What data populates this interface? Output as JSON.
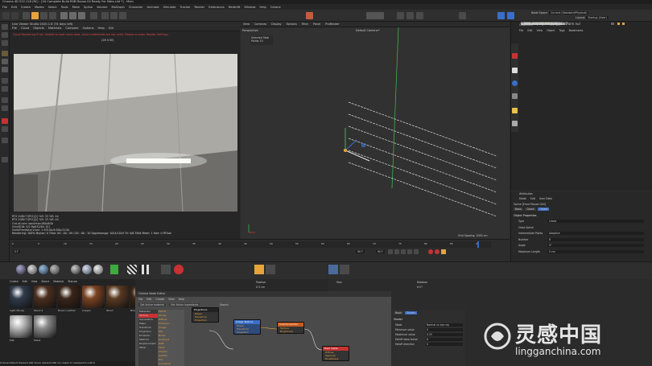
{
  "title": "Cinema 4D S22.118 (RC) - [04 Complete Build RSB Mouse 04 Ready For Mats.c4d *] - Main",
  "menubar": [
    "File",
    "Edit",
    "Create",
    "Modes",
    "Select",
    "Tools",
    "Mesh",
    "Spline",
    "Volume",
    "MoGraph",
    "Character",
    "Animate",
    "Simulate",
    "Tracker",
    "Render",
    "Extensions",
    "Redshift",
    "Window",
    "Help",
    "Octane"
  ],
  "node_space": {
    "label": "Node Space:",
    "value": "Current (Standard/Physical)"
  },
  "layout": {
    "label": "Layout:",
    "value": "Startup (User)"
  },
  "render_view": {
    "title": "Live Viewer Studio 2020.1.6 (74 days left)",
    "menu": [
      "File",
      "Cloud",
      "Objects",
      "Materials",
      "Compare",
      "Options",
      "Help",
      "GUI"
    ],
    "error": "Cloud Rendering Error: Unable to load cloud data, cloud credentials are not valid. Please re-enter Render Settings.",
    "zoom": "(28 0.50)",
    "stats": [
      "RTX 2080 TI(PCI)[1]   %R: 33   %R: 44",
      "RTX 2080 TI(PCI)[2]   %R: 33   %R: 44",
      "Out-of-core used/max:0Kb/6Gb",
      "Grey8/16: 0/2          Rgb32/64: 0/1",
      "Used/free/total vram: 1.991Gb/8.8Gb/11Gb",
      "Rendering: 100%  Ms/sec: 0  Time: 00 : 00 : 09 / 00 : 00 : 10  Spp/maxspp: 1024/1024  Tri: 0/6.764k  Mesh: 1  Hair: 0  RTXon"
    ]
  },
  "viewport": {
    "menu": [
      "View",
      "Cameras",
      "Display",
      "Options",
      "Filter",
      "Panel",
      "ProRender"
    ],
    "mode": "Perspective",
    "camera": "Default Camera:*",
    "selected_total": "Selected Total",
    "points": "Points   10",
    "grid_spacing": "Grid Spacing: 1000 cm"
  },
  "objects": {
    "title": "Objects",
    "menu": [
      "File",
      "Edit",
      "View",
      "Object",
      "Tags",
      "Bookmarks"
    ],
    "rows": [
      "Mouse Buttons Primary and Palm nul",
      "Mouse Center Strip",
      "Mouse Center Strip",
      "Mouse Center Button",
      "Mouse Wheel",
      "Mouse Wheel",
      "Subdivision Surface.2",
      "Mouse Left Click Button2",
      "Subdivision Surface.3",
      "Mouse Left Click Button1",
      "Subdivision Surface.4",
      "Mouse Side Buttons",
      "Mouse Side Button Upper",
      "Mouse Side Button Lower",
      "Subdivision Surface.9",
      "Subdivision Surface.10",
      "Front Mouse Grill",
      "Circle",
      "Front Mouse Grill",
      "Mouse Light Frame",
      "Mouse Bottom",
      "Subdivision Surface.13",
      "Mouse Bottom Slider",
      "Subdivision Surface.14",
      "Mouse Bottom Cap",
      "Subdivision Surface.15",
      "Subdivision Surface.16",
      "Backdrop.1",
      "Stage Null USB",
      "Cyclone Sweep"
    ]
  },
  "attributes": {
    "title": "Attributes",
    "menu": [
      "Mode",
      "Edit",
      "User Data"
    ],
    "object_label": "Spline [Front Mouse Grill]",
    "tabs": [
      "Basic",
      "Coord.",
      "Object"
    ],
    "section": "Object Properties",
    "rows": [
      {
        "label": "Type",
        "value": "Linear"
      },
      {
        "label": "Close Spline",
        "value": ""
      },
      {
        "label": "Intermediate Points",
        "value": "Adaptive"
      },
      {
        "label": "Number",
        "value": "8"
      },
      {
        "label": "Angle",
        "value": "5°"
      },
      {
        "label": "Maximum Length",
        "value": "5 cm"
      }
    ]
  },
  "timeline": {
    "start": "0 F",
    "end": "90 F",
    "current": "90 F",
    "ticks": [
      "0",
      "5",
      "10",
      "15",
      "20",
      "25",
      "30",
      "35",
      "40",
      "45",
      "50",
      "55",
      "60",
      "65",
      "70",
      "75",
      "80",
      "85",
      "90"
    ]
  },
  "materials": {
    "menu": [
      "Create",
      "Edit",
      "View",
      "Select",
      "Material",
      "Texture"
    ],
    "items": [
      {
        "name": "Light Mouse",
        "color": "#2f3a4a"
      },
      {
        "name": "Wood 2",
        "color": "#4a2e1e"
      },
      {
        "name": "Brown Leather",
        "color": "#3a2418"
      },
      {
        "name": "Copper",
        "color": "#7a4222"
      },
      {
        "name": "Wood",
        "color": "#5a3a22"
      },
      {
        "name": "Brown Leather",
        "color": "#3c2616"
      },
      {
        "name": "Mat",
        "color": "#b9b9b9"
      },
      {
        "name": "Metal",
        "color": "#8a8a8a"
      }
    ]
  },
  "coordinates": {
    "position": "Position",
    "size": "Size",
    "rotation": "Rotation",
    "x": "X  0 cm",
    "h": "H  0°"
  },
  "node_editor": {
    "title": "Octane Node Editor",
    "menu": [
      "File",
      "Edit",
      "Create",
      "View",
      "Help"
    ],
    "tabs": [
      "Get Active material",
      "Get Active Ingredients"
    ],
    "search_label": "Search",
    "categories": [
      "Materials",
      "Texture",
      "Generators",
      "Maps",
      "Transform",
      "Projection",
      "Emission",
      "Medium",
      "Displacement",
      "Other"
    ],
    "list": [
      "Falloff",
      "Glossy",
      "Diffuse",
      "Emission",
      "Image",
      "Mix",
      "Noise",
      "Gradient",
      "RGB",
      "Float",
      "Checks",
      "Scatter",
      "Dirt",
      "Curvature"
    ],
    "nodes": [
      {
        "title": "Projections",
        "ports": [
          "Power",
          "Transform",
          "Projection"
        ]
      },
      {
        "title": "Image Texture",
        "ports": [
          "Power",
          "Transform",
          "Projection"
        ]
      },
      {
        "title": "ColorCorrection",
        "ports": [
          "Texture",
          "Brightness"
        ]
      },
      {
        "title": "Dark Cable",
        "ports": [
          "Diffuse",
          "Specular",
          "Roughness"
        ]
      }
    ]
  },
  "shader": {
    "tabs": [
      "Basic",
      "Shader"
    ],
    "section": "Shader",
    "rows": [
      {
        "label": "Mode",
        "value": "Normal vs eye ray"
      },
      {
        "label": "Minimum value",
        "value": "0"
      },
      {
        "label": "Maximum value",
        "value": "0.25"
      },
      {
        "label": "Falloff skew factor",
        "value": "6"
      },
      {
        "label": "Falloff direction",
        "value": "0"
      }
    ]
  },
  "status": "Octane:Default Shader0.000   Check shader0.000 ms   clear0.11   loadGeo0.0   out0.0",
  "watermark": {
    "chinese": "灵感中国",
    "url": "lingganchina.com"
  },
  "colors": {
    "accent": "#e8a33a",
    "orange": "#d98a2c",
    "green_tag": "#3faa3f",
    "red": "#c83232",
    "blue": "#3a6ec8"
  }
}
